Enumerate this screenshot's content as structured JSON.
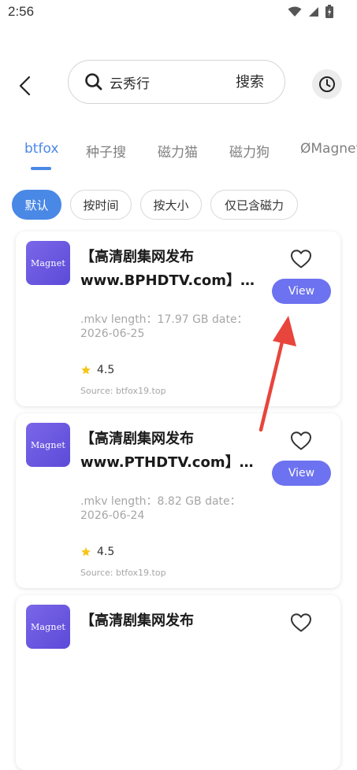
{
  "status_bar": {
    "time": "2:56",
    "icons": [
      "wifi-icon",
      "signal-icon",
      "battery-icon"
    ]
  },
  "header": {
    "back_icon": "back-arrow-icon",
    "search": {
      "value": "云秀行",
      "submit_label": "搜索"
    },
    "history_icon": "history-clock-icon"
  },
  "tabs": [
    {
      "label": "btfox",
      "active": true
    },
    {
      "label": "种子搜",
      "active": false
    },
    {
      "label": "磁力猫",
      "active": false
    },
    {
      "label": "磁力狗",
      "active": false
    },
    {
      "label": "ØMagnet",
      "active": false
    }
  ],
  "filters": [
    {
      "label": "默认",
      "active": true
    },
    {
      "label": "按时间",
      "active": false
    },
    {
      "label": "按大小",
      "active": false
    },
    {
      "label": "仅已含磁力",
      "active": false
    }
  ],
  "results": [
    {
      "thumb_text": "Magnet",
      "title_line1": "【高清剧集网发布",
      "title_line2": "www.BPHDTV.com】云秀行",
      "meta_line1": ".mkv length：17.97 GB date：",
      "meta_line2": "2026-06-25",
      "rating": "4.5",
      "source": "Source: btfox19.top",
      "view_label": "View"
    },
    {
      "thumb_text": "Magnet",
      "title_line1": "【高清剧集网发布",
      "title_line2": "www.PTHDTV.com】云秀行",
      "meta_line1": ".mkv length：8.82 GB date：",
      "meta_line2": "2026-06-24",
      "rating": "4.5",
      "source": "Source: btfox19.top",
      "view_label": "View"
    },
    {
      "thumb_text": "Magnet",
      "title_line1": "【高清剧集网发布",
      "title_line2": "",
      "meta_line1": "",
      "meta_line2": "",
      "rating": "",
      "source": "",
      "view_label": ""
    }
  ],
  "colors": {
    "accent": "#4a88e6",
    "view_button": "#6d72f0",
    "thumb_gradient_start": "#7a66e8",
    "thumb_gradient_end": "#5c4bd8",
    "star": "#f5c518",
    "annotation_arrow": "#e8453c"
  }
}
